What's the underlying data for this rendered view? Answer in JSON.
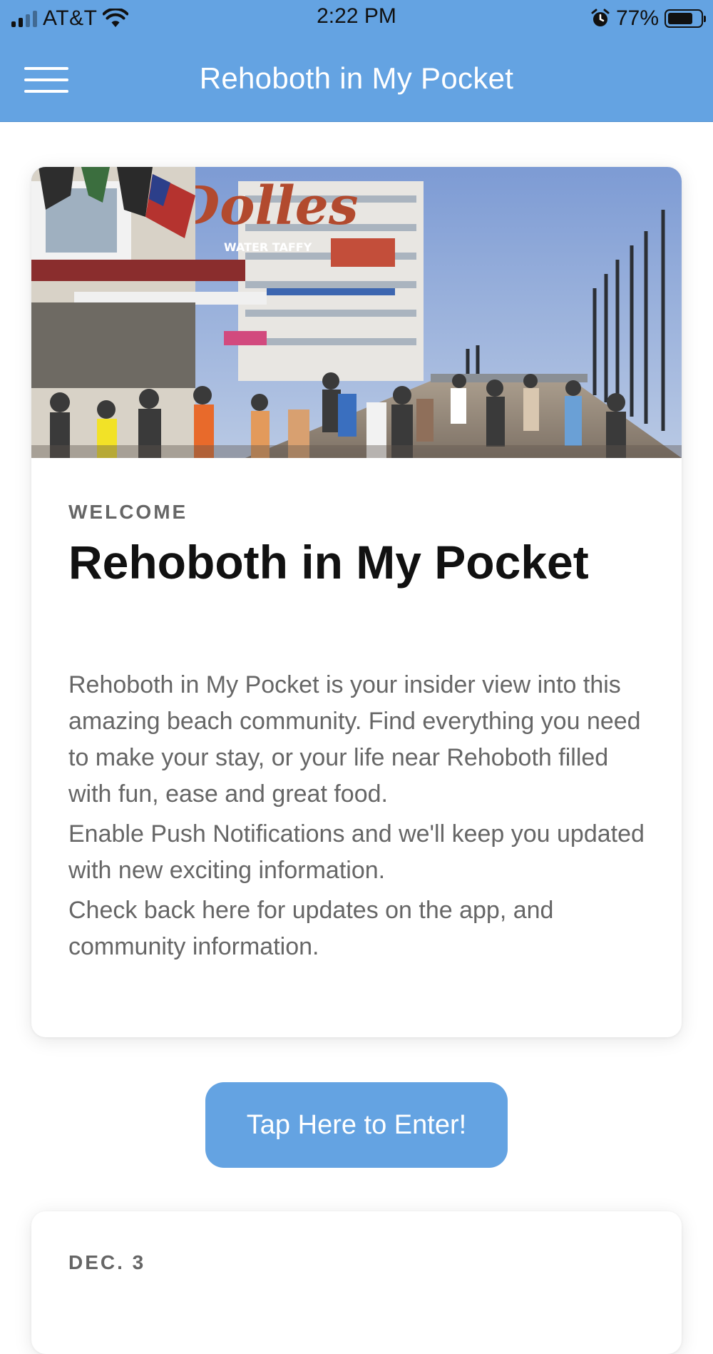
{
  "status_bar": {
    "carrier": "AT&T",
    "time": "2:22 PM",
    "battery_percent": "77%",
    "battery_level": 0.77,
    "signal_bars": 2,
    "icons": [
      "signal-icon",
      "wifi-icon",
      "alarm-icon",
      "battery-icon"
    ]
  },
  "header": {
    "title": "Rehoboth in My Pocket",
    "menu_icon": "hamburger-menu-icon",
    "background_color": "#64a3e2"
  },
  "welcome_card": {
    "image": "boardwalk-photo",
    "eyebrow": "WELCOME",
    "title": "Rehoboth in My Pocket",
    "paragraphs": [
      "Rehoboth in My Pocket is your insider view into this amazing beach community. Find everything you need to make your stay, or your life near Rehoboth filled with fun, ease and great food.",
      "Enable Push Notifications and we'll keep you updated with new exciting information.",
      "Check back here for updates on the app, and community information."
    ]
  },
  "enter_button": {
    "label": "Tap Here to Enter!",
    "color": "#64a3e2"
  },
  "next_card": {
    "date": "DEC. 3"
  }
}
